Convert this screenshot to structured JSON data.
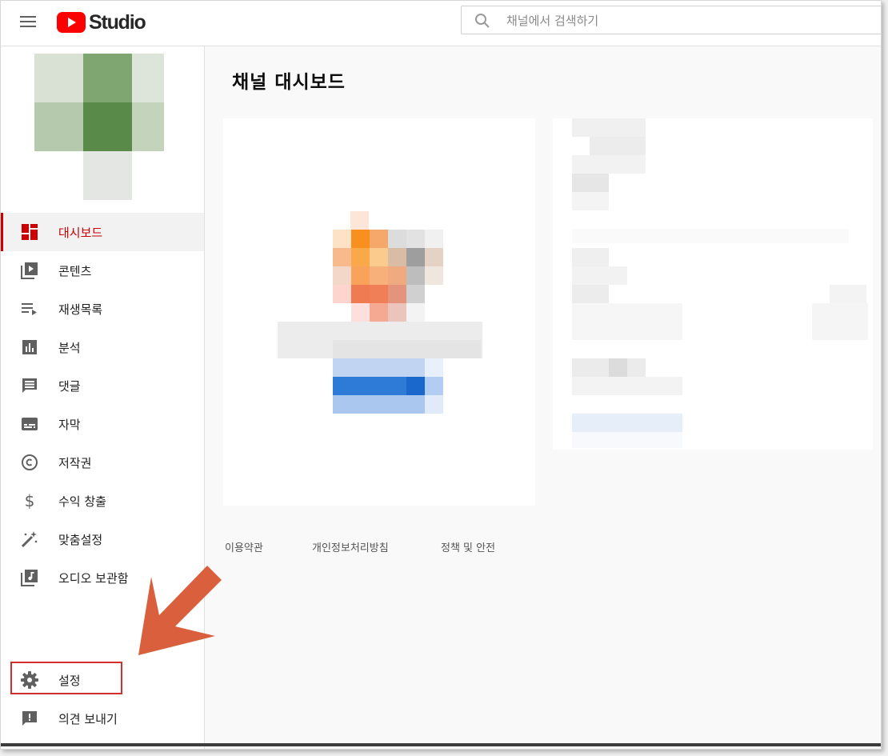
{
  "header": {
    "logo_text": "Studio",
    "search_placeholder": "채널에서 검색하기"
  },
  "sidebar": {
    "items": [
      {
        "label": "대시보드",
        "icon": "dashboard-icon"
      },
      {
        "label": "콘텐츠",
        "icon": "video-library-icon"
      },
      {
        "label": "재생목록",
        "icon": "playlist-icon"
      },
      {
        "label": "분석",
        "icon": "analytics-icon"
      },
      {
        "label": "댓글",
        "icon": "comment-icon"
      },
      {
        "label": "자막",
        "icon": "subtitles-icon"
      },
      {
        "label": "저작권",
        "icon": "copyright-icon"
      },
      {
        "label": "수익 창출",
        "icon": "dollar-icon"
      },
      {
        "label": "맞춤설정",
        "icon": "magic-wand-icon"
      },
      {
        "label": "오디오 보관함",
        "icon": "audio-library-icon"
      }
    ],
    "settings_label": "설정",
    "feedback_label": "의견 보내기"
  },
  "main": {
    "title": "채널 대시보드",
    "footer_links": [
      "이용약관",
      "개인정보처리방침",
      "정책 및 안전"
    ]
  },
  "colors": {
    "accent": "#cc0000",
    "annotation_arrow": "#d95f3d",
    "annotation_box": "#d32f2f"
  }
}
